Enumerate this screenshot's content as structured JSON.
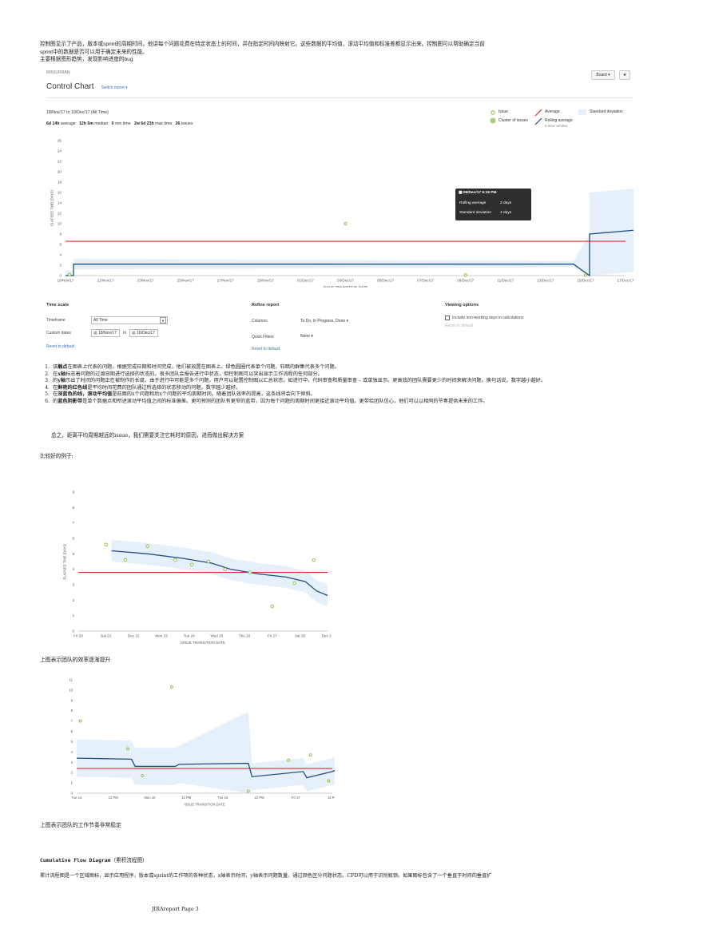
{
  "intro": {
    "line1": "控制图显示了产品，版本或sprint的周期时间，他讲每个问题花费在特定状态上的时间，并在指定时间内映射它。这些数据的平均值，滚动平均值和标准差都显示出来。控制图可以帮助确定当前",
    "line2": "sprint中的数据是否可以用于确定未来的性能。",
    "line3": "主要根据图形趋势，发现影响进度的bug"
  },
  "control_chart": {
    "project": "MINIURBAN",
    "title": "Control Chart",
    "switch_report": "Switch report ▾",
    "board_button": "Board ▾",
    "star_button": "★",
    "date_range": "18/Nov/17 to 10/Dec/17 (All Time)",
    "stats": [
      {
        "value": "6d 14h",
        "label": "average"
      },
      {
        "value": "12h 5m",
        "label": "median"
      },
      {
        "value": "0",
        "label": "min time"
      },
      {
        "value": "2w 6d 23h",
        "label": "max time"
      },
      {
        "value": "26",
        "label": "issues"
      }
    ],
    "legend": {
      "issue": "Issue",
      "cluster": "Cluster of issues",
      "average": "Average",
      "rolling": "Rolling average",
      "rolling_sub": "5 issue window",
      "stddev": "Standard deviation"
    },
    "tooltip": {
      "date": "09/Dec/17 6:19 PM",
      "rolling_label": "Rolling average",
      "rolling_value": "2 days",
      "std_label": "Standard deviation",
      "std_value": "4 days"
    },
    "time_scale": {
      "heading": "Time scale",
      "timeframe_label": "Timeframe",
      "timeframe_value": "All Time",
      "custom_label": "Custom dates",
      "from": "18/Nov/17",
      "to_word": "to",
      "to": "16/Dec/17",
      "reset": "Reset to default"
    },
    "refine": {
      "heading": "Refine report",
      "columns_label": "Columns",
      "columns_value": "To Do, In Progress, Done ▾",
      "quick_label": "Quick Filters",
      "quick_value": "None ▾",
      "reset": "Reset to default"
    },
    "viewing": {
      "heading": "Viewing options",
      "checkbox_label": "Include non-working days in calculations",
      "reset": "Reset to default"
    }
  },
  "chart_data": [
    {
      "type": "line",
      "xlabel": "ISSUE TRANSITION DATE",
      "ylabel": "ELAPSED TIME (DAYS)",
      "ylim": [
        0,
        26
      ],
      "yticks": [
        0,
        2,
        4,
        6,
        8,
        10,
        12,
        14,
        16,
        18,
        20,
        22,
        24,
        26
      ],
      "xticks": [
        "18/Nov/17",
        "21/Nov/17",
        "23/Nov/17",
        "25/Nov/17",
        "27/Nov/17",
        "29/Nov/17",
        "01/Dec/17",
        "03/Dec/17",
        "05/Dec/17",
        "07/Dec/17",
        "09/Dec/17",
        "11/Dec/17",
        "13/Dec/17",
        "15/Dec/17",
        "17/Dec/17"
      ],
      "average": 6.6,
      "series": [
        {
          "name": "Rolling average",
          "x": [
            0,
            0.2,
            0.2,
            12.7,
            13.1,
            13.1,
            14.6,
            14.65,
            14.9
          ],
          "y": [
            0,
            0,
            2.2,
            2.2,
            0,
            8,
            9,
            16.3,
            12.7
          ]
        },
        {
          "name": "Issue",
          "x": [
            0.1,
            7.0,
            10.0,
            13.0,
            14.6,
            14.65,
            14.95,
            14.95
          ],
          "y": [
            0.2,
            10,
            0.1,
            0.1,
            10,
            5,
            3,
            21
          ]
        },
        {
          "name": "Cluster of issues",
          "x": [
            14.6
          ],
          "y": [
            20
          ]
        }
      ]
    },
    {
      "type": "line",
      "xlabel": "ISSUE TRANSITION DATE",
      "ylabel": "ELAPSED TIME (DAYS)",
      "ylim": [
        0,
        9
      ],
      "yticks": [
        0,
        1,
        2,
        3,
        4,
        5,
        6,
        7,
        8,
        9
      ],
      "xticks": [
        "Fri 20",
        "Sat 21",
        "Dec 22",
        "Mon 23",
        "Tue 24",
        "Wed 25",
        "Thu 26",
        "Fri 27",
        "Sat 28",
        "Dec 29"
      ],
      "average": 3.8,
      "series": [
        {
          "name": "Rolling average",
          "x": [
            1.2,
            2.5,
            3.8,
            4.8,
            5.5,
            6.5,
            7.5,
            8.2,
            8.6,
            9.0
          ],
          "y": [
            5.2,
            5.0,
            4.7,
            4.4,
            4.0,
            3.7,
            3.5,
            3.2,
            2.6,
            2.3
          ]
        },
        {
          "name": "Issue",
          "x": [
            1.0,
            1.7,
            2.5,
            3.5,
            4.1,
            4.7,
            5.3,
            6.2,
            7.0,
            7.8,
            8.5
          ],
          "y": [
            5.6,
            4.6,
            5.5,
            4.6,
            4.3,
            4.5,
            4.0,
            3.8,
            1.6,
            3.1,
            4.6
          ]
        }
      ]
    },
    {
      "type": "line",
      "xlabel": "ISSUE TRANSITION DATE",
      "ylabel": "ELAPSED TIME (DAYS)",
      "ylim": [
        0,
        11
      ],
      "yticks": [
        0,
        1,
        2,
        3,
        4,
        5,
        6,
        7,
        8,
        9,
        10,
        11
      ],
      "xticks": [
        "Tue 14",
        "12 PM",
        "Mon 15",
        "12 PM",
        "Tue 16",
        "12 PM",
        "Fri 17",
        "12 PM"
      ],
      "average": 2.4,
      "series": [
        {
          "name": "Rolling average",
          "x": [
            0,
            1.5,
            1.6,
            2.7,
            2.8,
            4.7,
            4.8,
            6.2,
            6.3,
            7.0,
            7.3,
            10.0
          ],
          "y": [
            3.4,
            3.3,
            2.6,
            2.6,
            2.8,
            2.9,
            1.6,
            2.1,
            1.5,
            2.1,
            2.6,
            2.6
          ]
        },
        {
          "name": "Issue",
          "x": [
            0.1,
            1.4,
            1.8,
            2.6,
            4.7,
            5.8,
            6.4,
            6.9,
            7.2,
            7.8,
            8.1
          ],
          "y": [
            7.0,
            4.3,
            1.7,
            10.3,
            0.2,
            3.2,
            3.7,
            1.2,
            1.6,
            4.0,
            2.9
          ]
        }
      ]
    }
  ],
  "notes": [
    {
      "pre": "该",
      "bold": "触点",
      "post": "在图表上代表的问题。根据完成日期和时间完成，他们被放置在图表上。绿色圆圈代表单个问题，较暗的群集代表多个问题。"
    },
    {
      "pre": "在",
      "bold": "x轴",
      "post": "标志着问题的过渡日期进行选择的状态的。很多团队会报告进行中状态，但控制图可以突出显示工作流程的任何部分。"
    },
    {
      "pre": "的",
      "bold": "y轴",
      "post": "示出了时间的问题正在被制作的长度。由于进行中可能是多个问题，用户可以配置控制图以汇总状态，如进行中，代码审查和质量审查 – 或单独显示。更高效的团队需要更少的时间来解决问题。换句话说，数字越小越好。"
    },
    {
      "pre": "在",
      "bold": "鲜艳的红色线",
      "post": "是平均时间花费的团队通过所选择的状态移动的问题。数字越少越好。"
    },
    {
      "pre": "在",
      "bold": "深蓝色的线，滚动平均值",
      "post": "是前面的x个问题和后x个问题的平均周期时间。随着团队效率的提高，这条线将会向下倾斜。"
    },
    {
      "pre": "的",
      "bold": "蓝色阴影带",
      "post": "是单个数据点和所述滚动平均值之间的标准偏差。更可预测的团队有更窄的蓝带，因为每个问题的周期时间更接近滚动平均值。更带给团队信心，他们可以以相同的节奏提供未来的工作。"
    }
  ],
  "summary": "总之，距离平均周期越远的issue，我们需要关注它耗时的原因，进而做出解决方案",
  "good_example": "比较好的例子:",
  "caption1": "上图表示团队的效率逐渐提升",
  "caption2": "上图表示团队的工作节奏非常稳定",
  "cfd": {
    "title_en": "Cumulative Flow Diagram",
    "title_cn": "（累积流程图）",
    "desc": "累计流程图是一个区域图标，显示应用程序，版本或sprint的工作项的各种状态，x轴表示时间，y轴表示问题数量，通过颜色区分问题状态。CFD可以用于识别瓶颈。如果图标包含了一个垂直于时间的垂直扩"
  },
  "footer": "JIRAreport Page 3",
  "colors": {
    "average": "#d9322e",
    "rolling": "#205081",
    "band": "#e6f0fb",
    "issue": "#8cbd3f",
    "link": "#3b73af"
  }
}
